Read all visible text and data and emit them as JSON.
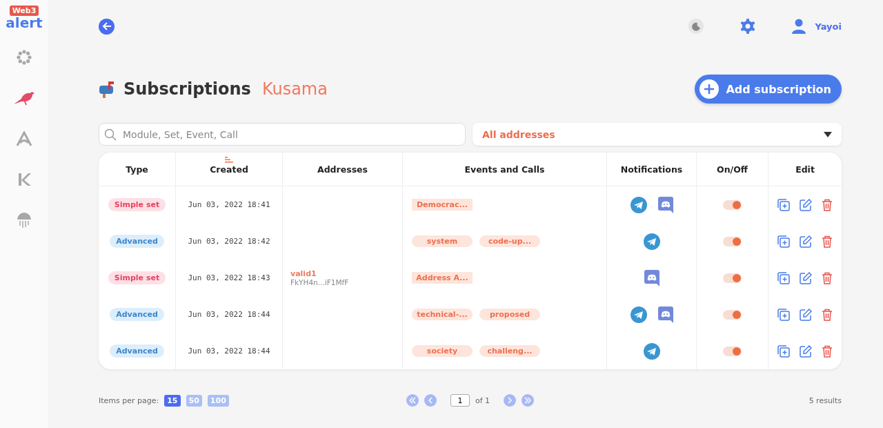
{
  "logo": {
    "badge": "Web3",
    "word": "alert"
  },
  "sidebar": {
    "items": [
      {
        "selected": false
      },
      {
        "selected": true
      },
      {
        "selected": false
      },
      {
        "selected": false
      },
      {
        "selected": false
      }
    ]
  },
  "header": {
    "user": "Yayoi"
  },
  "page": {
    "title": "Subscriptions",
    "network": "Kusama",
    "add_button": "Add subscription"
  },
  "search": {
    "placeholder": "Module, Set, Event, Call"
  },
  "address_filter": {
    "value": "All addresses"
  },
  "table": {
    "columns": [
      "Type",
      "Created",
      "Addresses",
      "Events and Calls",
      "Notifications",
      "On/Off",
      "Edit"
    ],
    "rows": [
      {
        "type": "Simple set",
        "kind": "simple",
        "created": "Jun 03, 2022 18:41",
        "address": null,
        "events": [
          {
            "label": "Democrac...",
            "kind": "set"
          }
        ],
        "telegram": true,
        "discord": true,
        "on": true
      },
      {
        "type": "Advanced",
        "kind": "advanced",
        "created": "Jun 03, 2022 18:42",
        "address": null,
        "events": [
          {
            "label": "system",
            "kind": "item"
          },
          {
            "label": "code-up...",
            "kind": "item"
          }
        ],
        "telegram": true,
        "discord": false,
        "on": true
      },
      {
        "type": "Simple set",
        "kind": "simple",
        "created": "Jun 03, 2022 18:43",
        "address": {
          "name": "valid1",
          "short": "FkYH4n...iF1MfF"
        },
        "events": [
          {
            "label": "Address A...",
            "kind": "set"
          }
        ],
        "telegram": false,
        "discord": true,
        "on": true
      },
      {
        "type": "Advanced",
        "kind": "advanced",
        "created": "Jun 03, 2022 18:44",
        "address": null,
        "events": [
          {
            "label": "technical-...",
            "kind": "item"
          },
          {
            "label": "proposed",
            "kind": "item"
          }
        ],
        "telegram": true,
        "discord": true,
        "on": true
      },
      {
        "type": "Advanced",
        "kind": "advanced",
        "created": "Jun 03, 2022 18:44",
        "address": null,
        "events": [
          {
            "label": "society",
            "kind": "item"
          },
          {
            "label": "challeng...",
            "kind": "item"
          }
        ],
        "telegram": true,
        "discord": false,
        "on": true
      }
    ]
  },
  "footer": {
    "per_page_label": "Items per page:",
    "per_page": [
      {
        "label": "15",
        "selected": true
      },
      {
        "label": "50",
        "selected": false
      },
      {
        "label": "100",
        "selected": false
      }
    ],
    "page": "1",
    "of": "of 1",
    "results": "5 results"
  }
}
